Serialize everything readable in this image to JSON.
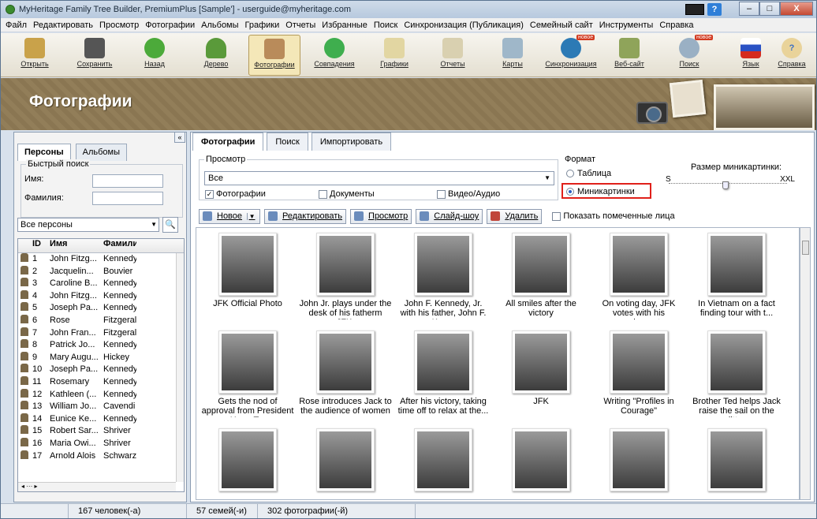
{
  "window": {
    "title": "MyHeritage Family Tree Builder, PremiumPlus [Sample'] - userguide@myheritage.com",
    "help": "?",
    "minimize": "–",
    "maximize": "□",
    "close": "X"
  },
  "menu": [
    "Файл",
    "Редактировать",
    "Просмотр",
    "Фотографии",
    "Альбомы",
    "Графики",
    "Отчеты",
    "Избранные",
    "Поиск",
    "Синхронизация (Публикация)",
    "Семейный сайт",
    "Инструменты",
    "Справка"
  ],
  "toolbar": {
    "items": [
      "Открыть",
      "Сохранить",
      "Назад",
      "Дерево",
      "Фотографии",
      "Совпадения",
      "Графики",
      "Отчеты",
      "Карты",
      "Синхронизация",
      "Веб-сайт",
      "Поиск",
      "Язык",
      "Справка"
    ],
    "badge": "новое",
    "help_glyph": "?"
  },
  "banner": {
    "title": "Фотографии"
  },
  "left": {
    "tabs": [
      "Персоны",
      "Альбомы"
    ],
    "quick_search": "Быстрый поиск",
    "name_label": "Имя:",
    "surname_label": "Фамилия:",
    "filter": "Все персоны",
    "columns": [
      "ID",
      "Имя",
      "Фамили"
    ],
    "rows": [
      [
        "1",
        "John Fitzg...",
        "Kennedy"
      ],
      [
        "2",
        "Jacquelin...",
        "Bouvier"
      ],
      [
        "3",
        "Caroline B...",
        "Kennedy"
      ],
      [
        "4",
        "John Fitzg...",
        "Kennedy"
      ],
      [
        "5",
        "Joseph Pa...",
        "Kennedy"
      ],
      [
        "6",
        "Rose",
        "Fitzgeral"
      ],
      [
        "7",
        "John Fran...",
        "Fitzgeral"
      ],
      [
        "8",
        "Patrick Jo...",
        "Kennedy"
      ],
      [
        "9",
        "Mary Augu...",
        "Hickey"
      ],
      [
        "10",
        "Joseph Pa...",
        "Kennedy"
      ],
      [
        "11",
        "Rosemary",
        "Kennedy"
      ],
      [
        "12",
        "Kathleen (...",
        "Kennedy"
      ],
      [
        "13",
        "William Jo...",
        "Cavendi"
      ],
      [
        "14",
        "Eunice Ke...",
        "Kennedy"
      ],
      [
        "15",
        "Robert Sar...",
        "Shriver"
      ],
      [
        "16",
        "Maria Owi...",
        "Shriver"
      ],
      [
        "17",
        "Arnold Alois",
        "Schwarz"
      ]
    ]
  },
  "main": {
    "tabs": [
      "Фотографии",
      "Поиск",
      "Импортировать"
    ],
    "view_label": "Просмотр",
    "view_value": "Все",
    "checks": [
      {
        "label": "Фотографии",
        "checked": true
      },
      {
        "label": "Документы",
        "checked": false
      },
      {
        "label": "Видео/Аудио",
        "checked": false
      }
    ],
    "format_label": "Формат",
    "format_options": [
      "Таблица",
      "Миникартинки"
    ],
    "format_selected": "Миникартинки",
    "size_label": "Размер миникартинки:",
    "size_min": "S",
    "size_max": "XXL",
    "actions": [
      "Новое",
      "Редактировать",
      "Просмотр",
      "Слайд-шоу",
      "Удалить"
    ],
    "show_faces": "Показать помеченные лица",
    "photos": [
      "JFK Official Photo",
      "John Jr. plays under the desk of his fatherm JFK.",
      "John F. Kennedy, Jr. with his father, John F. Ken...",
      "All smiles after the victory",
      "On voting day, JFK votes with his grandparents",
      "In Vietnam on a fact finding tour with t...",
      "Gets the nod of approval from President Harry T...",
      "Rose introduces Jack to the audience of women",
      "After his victory, taking time off to relax at the...",
      "JFK",
      "Writing \"Profiles in Courage\"",
      "Brother Ted helps Jack raise the sail on the litt...",
      "",
      "",
      "",
      "",
      "",
      ""
    ]
  },
  "status": [
    "167 человек(-а)",
    "57 семей(-и)",
    "302 фотографии(-й)"
  ],
  "colors": {
    "highlight_box": "#e0201a",
    "banner": "#8e7a55"
  }
}
